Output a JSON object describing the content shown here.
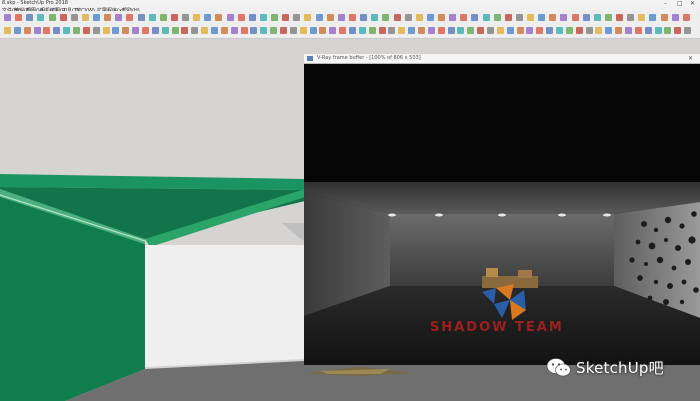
{
  "app": {
    "window_title": "8.skp - SketchUp Pro 2018"
  },
  "menu": {
    "items": [
      "文件(F)",
      "编辑(E)",
      "视图(V)",
      "相机(C)",
      "绘图(R)",
      "工具(T)",
      "窗口(W)",
      "扩展程序(x)",
      "帮助(H)"
    ]
  },
  "vray_window": {
    "title": "V-Ray frame buffer - [100% of 806 x 503]",
    "close": "✕"
  },
  "overlay": {
    "shadow_team": "SHADOW TEAM",
    "watermark": "SketchUp吧"
  },
  "colors": {
    "green_wall": "#0f7d4e",
    "green_ceiling": "#1a9461",
    "white_wall": "#efefef",
    "floor": "#6f6f6f",
    "render_bg": "#060606",
    "watermark_red": "#b3201e"
  }
}
